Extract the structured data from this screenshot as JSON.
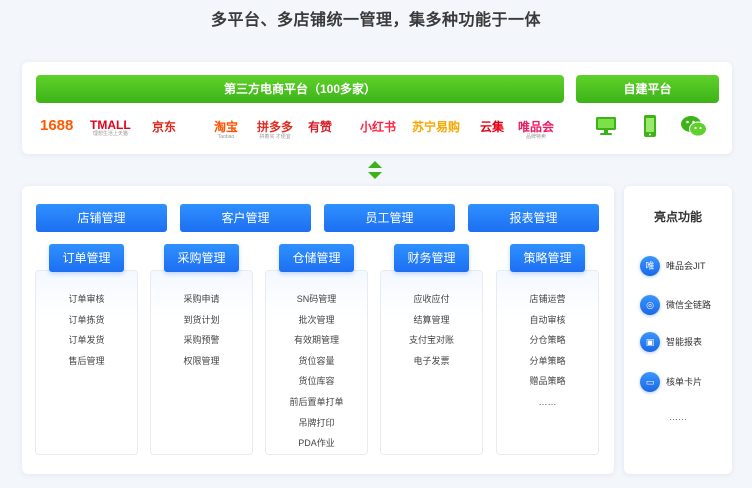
{
  "title": "多平台、多店铺统一管理，集多种功能于一体",
  "platform": {
    "third_party_label": "第三方电商平台（100多家）",
    "self_built_label": "自建平台",
    "logos": [
      {
        "text": "1688",
        "color": "#ff5a00"
      },
      {
        "text": "TMALL",
        "sub": "理想生活上天猫",
        "color": "#e3001b"
      },
      {
        "text": "京东",
        "color": "#e1251b"
      },
      {
        "text": "淘宝",
        "sub": "Taobao",
        "color": "#ff5000"
      },
      {
        "text": "拼多多",
        "sub": "拼着买 才便宜",
        "color": "#e02e24"
      },
      {
        "text": "有赞",
        "color": "#d81f26"
      },
      {
        "text": "小红书",
        "color": "#ff2442"
      },
      {
        "text": "苏宁易购",
        "color": "#f7a700"
      },
      {
        "text": "云集",
        "color": "#e60012"
      },
      {
        "text": "唯品会",
        "sub": "品牌特卖",
        "color": "#e91e63"
      }
    ],
    "self_icons": [
      "desktop-icon",
      "mobile-icon",
      "wechat-icon"
    ],
    "green": "#44b91c"
  },
  "modules": [
    {
      "label": "店铺管理"
    },
    {
      "label": "客户管理"
    },
    {
      "label": "员工管理"
    },
    {
      "label": "报表管理"
    }
  ],
  "columns": [
    {
      "title": "订单管理",
      "items": [
        "订单审核",
        "订单拣货",
        "订单发货",
        "售后管理"
      ]
    },
    {
      "title": "采购管理",
      "items": [
        "采购申请",
        "到货计划",
        "采购预警",
        "权限管理"
      ]
    },
    {
      "title": "仓储管理",
      "items": [
        "SN码管理",
        "批次管理",
        "有效期管理",
        "货位容量",
        "货位库容",
        "前后置单打单",
        "吊牌打印",
        "PDA作业"
      ]
    },
    {
      "title": "财务管理",
      "items": [
        "应收应付",
        "结算管理",
        "支付宝对账",
        "电子发票"
      ]
    },
    {
      "title": "策略管理",
      "items": [
        "店铺运营",
        "自动审核",
        "分仓策略",
        "分单策略",
        "赠品策略",
        "……"
      ]
    }
  ],
  "highlights": {
    "title": "亮点功能",
    "items": [
      {
        "icon": "唯",
        "icon_name": "vip-icon",
        "label": "唯品会JIT"
      },
      {
        "icon": "◎",
        "icon_name": "chat-icon",
        "label": "微信全链路"
      },
      {
        "icon": "▣",
        "icon_name": "report-icon",
        "label": "智能报表"
      },
      {
        "icon": "▭",
        "icon_name": "card-icon",
        "label": "核单卡片"
      }
    ],
    "more": "……"
  },
  "accent": "#1d6ff2"
}
